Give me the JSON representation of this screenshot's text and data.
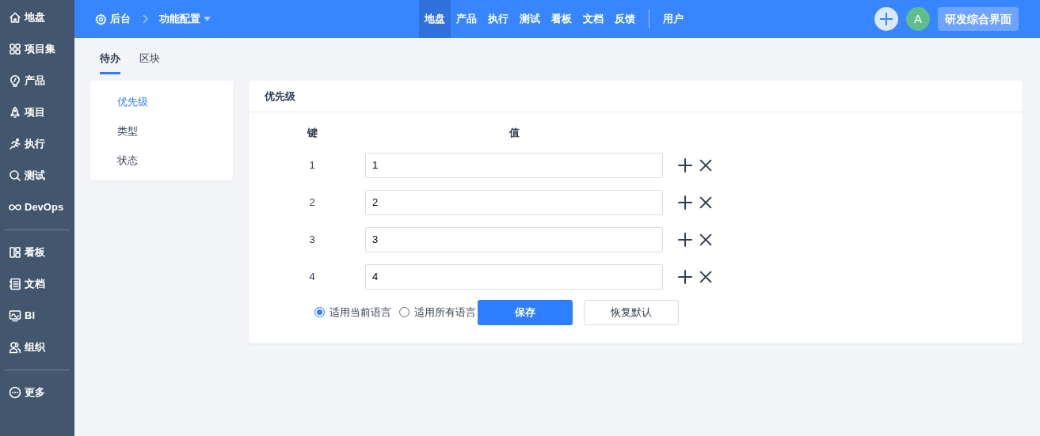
{
  "sidebar": {
    "groups": [
      {
        "items": [
          {
            "label": "地盘"
          },
          {
            "label": "项目集"
          },
          {
            "label": "产品"
          },
          {
            "label": "项目"
          },
          {
            "label": "执行"
          },
          {
            "label": "测试"
          },
          {
            "label": "DevOps"
          }
        ]
      },
      {
        "items": [
          {
            "label": "看板"
          },
          {
            "label": "文档"
          },
          {
            "label": "BI"
          },
          {
            "label": "组织"
          }
        ]
      },
      {
        "items": [
          {
            "label": "更多"
          }
        ]
      }
    ]
  },
  "topbar": {
    "breadcrumb": [
      {
        "label": "后台"
      },
      {
        "label": "功能配置"
      }
    ],
    "nav": [
      {
        "label": "地盘",
        "selected": true
      },
      {
        "label": "产品",
        "selected": false
      },
      {
        "label": "执行",
        "selected": false
      },
      {
        "label": "测试",
        "selected": false
      },
      {
        "label": "看板",
        "selected": false
      },
      {
        "label": "文档",
        "selected": false
      },
      {
        "label": "反馈",
        "selected": false
      }
    ],
    "nav_extra": [
      {
        "label": "用户",
        "selected": false
      }
    ],
    "avatar": "A",
    "workspace_button": "研发综合界面"
  },
  "tabs": [
    {
      "label": "待办",
      "selected": true
    },
    {
      "label": "区块",
      "selected": false
    }
  ],
  "menu": [
    {
      "label": "优先级",
      "selected": true
    },
    {
      "label": "类型",
      "selected": false
    },
    {
      "label": "状态",
      "selected": false
    }
  ],
  "panel": {
    "title": "优先级",
    "columns": [
      "键",
      "值"
    ],
    "rows": [
      {
        "key": "1",
        "value": "1"
      },
      {
        "key": "2",
        "value": "2"
      },
      {
        "key": "3",
        "value": "3"
      },
      {
        "key": "4",
        "value": "4"
      }
    ],
    "scope": [
      {
        "label": "适用当前语言",
        "selected": true
      },
      {
        "label": "适用所有语言",
        "selected": false
      }
    ],
    "save_button": "保存",
    "reset_button": "恢复默认"
  }
}
